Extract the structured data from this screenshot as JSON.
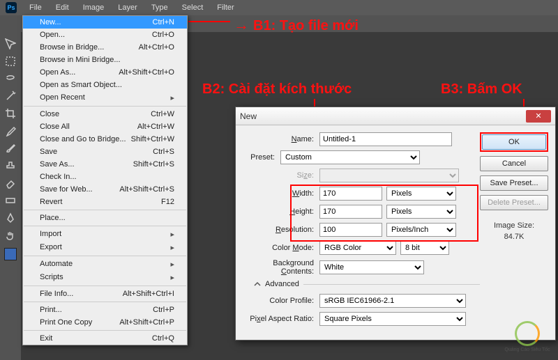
{
  "menubar": [
    "File",
    "Edit",
    "Image",
    "Layer",
    "Type",
    "Select",
    "Filter"
  ],
  "file_menu": {
    "new": {
      "label": "New...",
      "shortcut": "Ctrl+N"
    },
    "open": {
      "label": "Open...",
      "shortcut": "Ctrl+O"
    },
    "browse": {
      "label": "Browse in Bridge...",
      "shortcut": "Alt+Ctrl+O"
    },
    "browse_mini": {
      "label": "Browse in Mini Bridge...",
      "shortcut": ""
    },
    "open_as": {
      "label": "Open As...",
      "shortcut": "Alt+Shift+Ctrl+O"
    },
    "open_smart": {
      "label": "Open as Smart Object...",
      "shortcut": ""
    },
    "open_recent": {
      "label": "Open Recent",
      "shortcut": ""
    },
    "close": {
      "label": "Close",
      "shortcut": "Ctrl+W"
    },
    "close_all": {
      "label": "Close All",
      "shortcut": "Alt+Ctrl+W"
    },
    "close_bridge": {
      "label": "Close and Go to Bridge...",
      "shortcut": "Shift+Ctrl+W"
    },
    "save": {
      "label": "Save",
      "shortcut": "Ctrl+S"
    },
    "save_as": {
      "label": "Save As...",
      "shortcut": "Shift+Ctrl+S"
    },
    "check_in": {
      "label": "Check In...",
      "shortcut": ""
    },
    "save_web": {
      "label": "Save for Web...",
      "shortcut": "Alt+Shift+Ctrl+S"
    },
    "revert": {
      "label": "Revert",
      "shortcut": "F12"
    },
    "place": {
      "label": "Place...",
      "shortcut": ""
    },
    "import": {
      "label": "Import",
      "shortcut": ""
    },
    "export": {
      "label": "Export",
      "shortcut": ""
    },
    "automate": {
      "label": "Automate",
      "shortcut": ""
    },
    "scripts": {
      "label": "Scripts",
      "shortcut": ""
    },
    "file_info": {
      "label": "File Info...",
      "shortcut": "Alt+Shift+Ctrl+I"
    },
    "print": {
      "label": "Print...",
      "shortcut": "Ctrl+P"
    },
    "print_one": {
      "label": "Print One Copy",
      "shortcut": "Alt+Shift+Ctrl+P"
    },
    "exit": {
      "label": "Exit",
      "shortcut": "Ctrl+Q"
    }
  },
  "annotations": {
    "b1": "B1: Tạo file mới",
    "b2": "B2: Cài đặt kích thước",
    "b3": "B3: Bấm OK"
  },
  "dialog": {
    "title": "New",
    "labels": {
      "name": "Name:",
      "preset": "Preset:",
      "size": "Size:",
      "width": "Width:",
      "height": "Height:",
      "resolution": "Resolution:",
      "color_mode": "Color Mode:",
      "bg": "Background Contents:",
      "advanced": "Advanced",
      "color_profile": "Color Profile:",
      "par": "Pixel Aspect Ratio:",
      "image_size": "Image Size:"
    },
    "values": {
      "name": "Untitled-1",
      "preset": "Custom",
      "size": "",
      "width": "170",
      "height": "170",
      "resolution": "100",
      "width_unit": "Pixels",
      "height_unit": "Pixels",
      "res_unit": "Pixels/Inch",
      "color_mode": "RGB Color",
      "bit_depth": "8 bit",
      "bg": "White",
      "color_profile": "sRGB IEC61966-2.1",
      "par": "Square Pixels",
      "image_size": "84.7K"
    },
    "buttons": {
      "ok": "OK",
      "cancel": "Cancel",
      "save_preset": "Save Preset...",
      "delete_preset": "Delete Preset..."
    }
  },
  "watermark": "Quảng Cáo Siêu Tốc",
  "colors": {
    "accent": "#3399ff",
    "annotation": "#ff0000"
  }
}
